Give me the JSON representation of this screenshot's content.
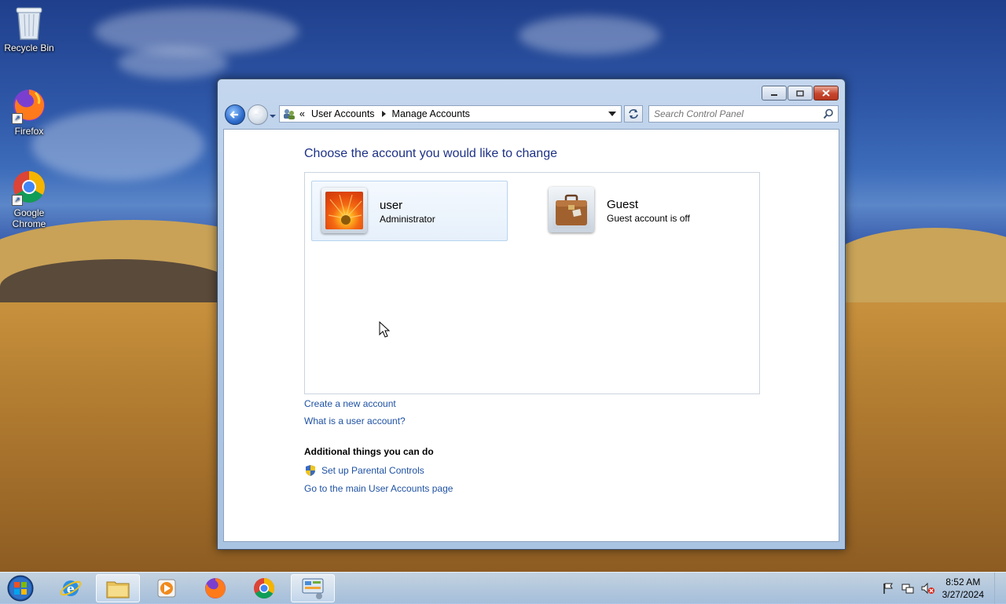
{
  "desktop": {
    "icons": [
      {
        "label": "Recycle Bin",
        "icon": "recycle-bin-icon"
      },
      {
        "label": "Firefox",
        "icon": "firefox-icon"
      },
      {
        "label": "Google Chrome",
        "icon": "chrome-icon"
      }
    ]
  },
  "window": {
    "address": {
      "chevron": "«",
      "crumbs": [
        "User Accounts",
        "Manage Accounts"
      ]
    },
    "search": {
      "placeholder": "Search Control Panel"
    },
    "content": {
      "heading": "Choose the account you would like to change",
      "accounts": [
        {
          "name": "user",
          "detail": "Administrator",
          "selected": true,
          "picture": "orange-flower-picture"
        },
        {
          "name": "Guest",
          "detail": "Guest account is off",
          "selected": false,
          "picture": "briefcase-picture"
        }
      ],
      "links": {
        "create": "Create a new account",
        "what_is": "What is a user account?"
      },
      "additional": {
        "heading": "Additional things you can do",
        "parental": "Set up Parental Controls",
        "main_page": "Go to the main User Accounts page"
      }
    }
  },
  "taskbar": {
    "pinned": [
      "start-orb-icon",
      "internet-explorer-icon",
      "file-explorer-icon",
      "media-player-icon",
      "firefox-icon",
      "chrome-icon",
      "control-panel-icon"
    ],
    "active": "control-panel-icon",
    "tray": [
      "action-center-flag-icon",
      "network-icon",
      "volume-muted-icon"
    ],
    "clock": {
      "time": "8:52 AM",
      "date": "3/27/2024"
    }
  },
  "colors": {
    "heading": "#1e3287",
    "link": "#1f52a3"
  }
}
